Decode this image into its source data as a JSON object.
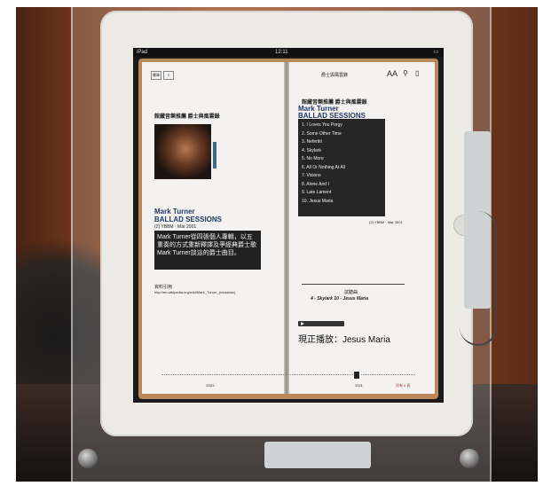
{
  "status_bar": {
    "device": "iPad",
    "time": "12:11"
  },
  "toolbar": {
    "library_label": "書庫",
    "list_icon": "list-icon",
    "font_size_label": "AA",
    "search_icon": "search-icon",
    "bookmark_icon": "bookmark-icon"
  },
  "left_page": {
    "header": "館藏音樂推薦  爵士與風雲錄",
    "artist_name": "Mark Turner",
    "album_title": "BALLAD SESSIONS",
    "catalog": "(2) YBBM · Mar 2001",
    "description": "Mark Turner從四張個人專輯，以五重奏的方式重新釋譯及爭經典爵士歌Mark Turner談這的爵士曲目。",
    "footer_label": "資料引用",
    "footer_url": "http://en.wikipedia.org/wiki/Mark_Turner_(musician)",
    "page_number": "/3321"
  },
  "right_page": {
    "top_title": "爵士與風雲錄",
    "header": "館藏音樂推薦  爵士與風雲錄",
    "artist_name": "Mark Turner",
    "album_title": "BALLAD SESSIONS",
    "tracks": [
      "1. I Loves You Porgy",
      "2. Some Other Time",
      "3. Nefertiti",
      "4. Skylark",
      "5. No More",
      "6. All Or Nothing At All",
      "7. Visions",
      "8. Alone And I",
      "9. Late Lament",
      "10. Jesus Maria"
    ],
    "catalog": "(2) YBBM · Mar 2001",
    "featured_heading": "試聽曲",
    "featured_tracks": "4 - Skylark   10 - Jesus Maria",
    "now_playing": "現正播放：Jesus Maria",
    "page_number": "3321",
    "pages_left": "尚有 6 頁"
  }
}
